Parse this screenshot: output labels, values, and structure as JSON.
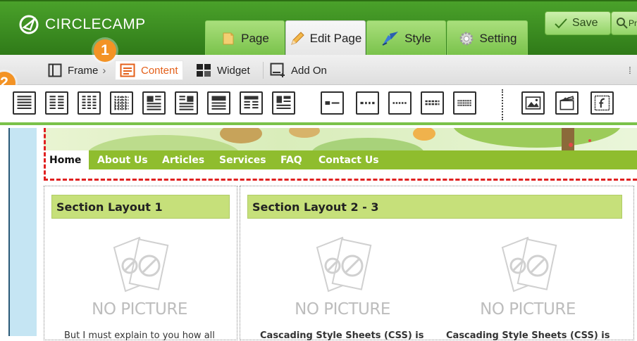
{
  "brand": {
    "name": "CIRCLECAMP",
    "accent": "#3a8a20",
    "badge_color": "#f39325"
  },
  "main_tabs": [
    {
      "label": "Page",
      "icon": "page-icon"
    },
    {
      "label": "Edit Page",
      "icon": "pencil-icon",
      "active": true
    },
    {
      "label": "Style",
      "icon": "brush-icon"
    },
    {
      "label": "Setting",
      "icon": "gear-icon"
    }
  ],
  "actions": {
    "save": "Save",
    "preview": "Pr"
  },
  "subtoolbar": {
    "frame": "Frame",
    "content": "Content",
    "widget": "Widget",
    "addon": "Add On",
    "active": "Content"
  },
  "badges": {
    "one": "1",
    "two": "2"
  },
  "layout_tools": [
    "layout-1-col",
    "layout-2-col",
    "layout-3-col",
    "layout-4-col",
    "layout-image-left",
    "layout-image-right",
    "layout-text-block",
    "layout-grid",
    "layout-title-text",
    "layout-row-1",
    "layout-row-2",
    "layout-row-3",
    "layout-row-4",
    "layout-row-5",
    "image-tool",
    "video-tool",
    "flash-tool"
  ],
  "site_nav": [
    "Home",
    "About Us",
    "Articles",
    "Services",
    "FAQ",
    "Contact Us"
  ],
  "sections": [
    {
      "title": "Section Layout 1",
      "nopic": "NO PICTURE",
      "text": "But I must explain to you how all"
    },
    {
      "title": "Section Layout 2 - 3",
      "nopic": "NO PICTURE",
      "text": "Cascading Style Sheets (CSS) is",
      "nopic2": "NO PICTURE",
      "text2": "Cascading Style Sheets (CSS) is"
    }
  ]
}
